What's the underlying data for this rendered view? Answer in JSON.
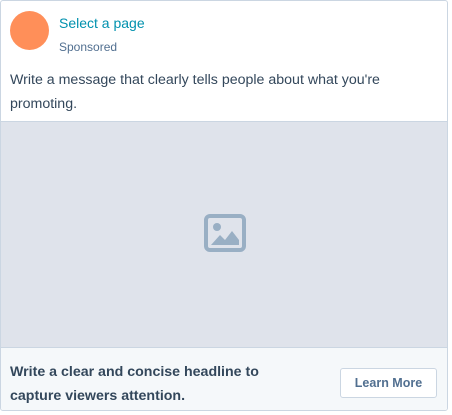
{
  "post": {
    "page_link": "Select a page",
    "sponsored_label": "Sponsored",
    "message": "Write a message that clearly tells people about what you're promoting.",
    "media_icon": "image-placeholder-icon"
  },
  "footer": {
    "headline": "Write a clear and concise headline to capture viewers attention.",
    "cta_label": "Learn More"
  },
  "colors": {
    "avatar": "#ff8f59",
    "link": "#0091ae",
    "text": "#33475b",
    "secondary_text": "#516f90",
    "media_background": "#dfe3eb",
    "footer_background": "#f5f8fa",
    "border": "#cbd6e2"
  }
}
